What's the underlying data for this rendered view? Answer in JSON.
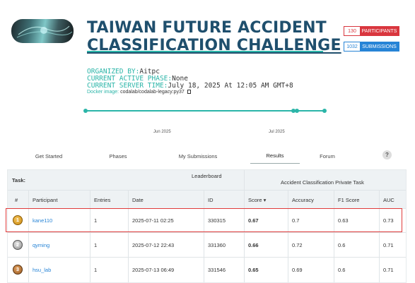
{
  "header": {
    "title_line1": "TAIWAN FUTURE ACCIDENT",
    "title_line2": "CLASSIFICATION CHALLENGE",
    "participants": {
      "count": "130",
      "label": "PARTICIPANTS"
    },
    "submissions": {
      "count": "1032",
      "label": "SUBMISSIONS"
    }
  },
  "info": {
    "organized_by_label": "ORGANIZED BY:",
    "organized_by": "Aitpc",
    "phase_label": "CURRENT ACTIVE PHASE:",
    "phase": "None",
    "time_label": "CURRENT SERVER TIME:",
    "time": "July 18, 2025 At 12:05 AM GMT+8",
    "docker_label": "Docker image:",
    "docker": "codalab/codalab-legacy:py37"
  },
  "timeline": {
    "labels": [
      "Jun 2025",
      "Jul 2025"
    ]
  },
  "tabs": [
    "Get Started",
    "Phases",
    "My Submissions",
    "Results",
    "Forum"
  ],
  "help_label": "?",
  "leaderboard": {
    "task_label": "Task:",
    "leaderboard_label": "Leaderboard",
    "task_name": "Accident Classification Private Task",
    "columns": {
      "rank": "#",
      "participant": "Participant",
      "entries": "Entries",
      "date": "Date",
      "id": "ID",
      "score": "Score ▾",
      "accuracy": "Accuracy",
      "f1": "F1 Score",
      "auc": "AUC"
    },
    "rows": [
      {
        "rank": "1",
        "participant": "kane110",
        "entries": "1",
        "date": "2025-07-11 02:25",
        "id": "330315",
        "score": "0.67",
        "accuracy": "0.7",
        "f1": "0.63",
        "auc": "0.73"
      },
      {
        "rank": "2",
        "participant": "qyming",
        "entries": "1",
        "date": "2025-07-12 22:43",
        "id": "331360",
        "score": "0.66",
        "accuracy": "0.72",
        "f1": "0.6",
        "auc": "0.71"
      },
      {
        "rank": "3",
        "participant": "hsu_lab",
        "entries": "1",
        "date": "2025-07-13 06:49",
        "id": "331546",
        "score": "0.65",
        "accuracy": "0.69",
        "f1": "0.6",
        "auc": "0.71"
      }
    ]
  }
}
